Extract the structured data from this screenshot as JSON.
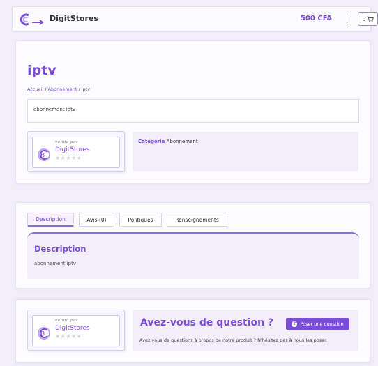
{
  "header": {
    "brand": "DigitStores",
    "price": "500 CFA",
    "cart_count": "0"
  },
  "product": {
    "title": "iptv",
    "breadcrumb": {
      "home": "Accueil",
      "category": "Abonnement",
      "current": "iptv",
      "separator": "/"
    },
    "short_description": "abonnement iptv",
    "category_label": "Catégorie",
    "category_value": "Abonnement"
  },
  "vendor": {
    "by_label": "vendu par",
    "name": "DigitStores",
    "rating": 0,
    "stars": "★★★★★"
  },
  "tabs": [
    {
      "label": "Description",
      "active": true
    },
    {
      "label": "Avis (0)",
      "active": false
    },
    {
      "label": "Politiques",
      "active": false
    },
    {
      "label": "Renseignements",
      "active": false
    }
  ],
  "description_panel": {
    "heading": "Description",
    "text": "abonnement iptv"
  },
  "question": {
    "title": "Avez-vous de question ?",
    "button_label": "Poser une question",
    "button_icon": "?",
    "text": "Avez-vous de questions à propos de notre produit ? N'hésitez pas à nous les poser."
  },
  "colors": {
    "accent": "#7c4dd6",
    "background": "#f1eefa"
  }
}
